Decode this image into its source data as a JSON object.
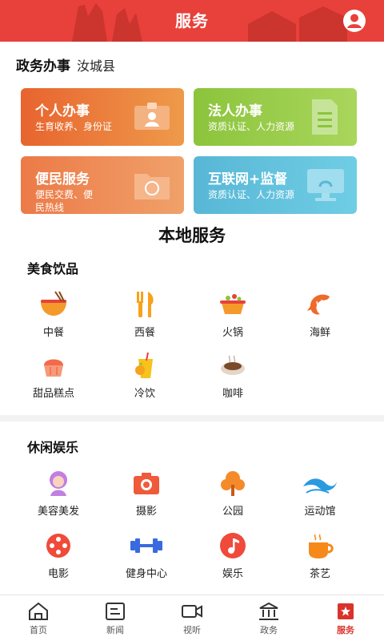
{
  "header": {
    "title": "服务"
  },
  "gov": {
    "heading": "政务办事",
    "location": "汝城县",
    "cards": [
      {
        "title": "个人办事",
        "sub": "生育收养、身份证"
      },
      {
        "title": "法人办事",
        "sub": "资质认证、人力资源"
      },
      {
        "title": "便民服务",
        "sub": "便民交费、便民热线"
      },
      {
        "title": "互联网+监督",
        "sub": "资质认证、人力资源"
      }
    ]
  },
  "local": {
    "title": "本地服务",
    "food": {
      "title": "美食饮品",
      "items": [
        {
          "label": "中餐",
          "icon": "noodle-bowl-icon"
        },
        {
          "label": "西餐",
          "icon": "fork-knife-icon"
        },
        {
          "label": "火锅",
          "icon": "hotpot-icon"
        },
        {
          "label": "海鲜",
          "icon": "shrimp-icon"
        },
        {
          "label": "甜品糕点",
          "icon": "cupcake-icon"
        },
        {
          "label": "冷饮",
          "icon": "cold-drink-icon"
        },
        {
          "label": "咖啡",
          "icon": "coffee-icon"
        }
      ]
    },
    "leisure": {
      "title": "休闲娱乐",
      "items": [
        {
          "label": "美容美发",
          "icon": "hair-salon-icon"
        },
        {
          "label": "摄影",
          "icon": "camera-icon"
        },
        {
          "label": "公园",
          "icon": "tree-icon"
        },
        {
          "label": "运动馆",
          "icon": "wave-icon"
        },
        {
          "label": "电影",
          "icon": "film-reel-icon"
        },
        {
          "label": "健身中心",
          "icon": "dumbbell-icon"
        },
        {
          "label": "娱乐",
          "icon": "music-note-icon"
        },
        {
          "label": "茶艺",
          "icon": "tea-cup-icon"
        }
      ]
    }
  },
  "tabbar": [
    {
      "label": "首页",
      "icon": "home-icon"
    },
    {
      "label": "新闻",
      "icon": "news-icon"
    },
    {
      "label": "视听",
      "icon": "video-icon"
    },
    {
      "label": "政务",
      "icon": "government-icon"
    },
    {
      "label": "服务",
      "icon": "service-icon",
      "active": true
    }
  ],
  "colors": {
    "brand_red": "#e8403a",
    "active_tab": "#d9332b"
  }
}
